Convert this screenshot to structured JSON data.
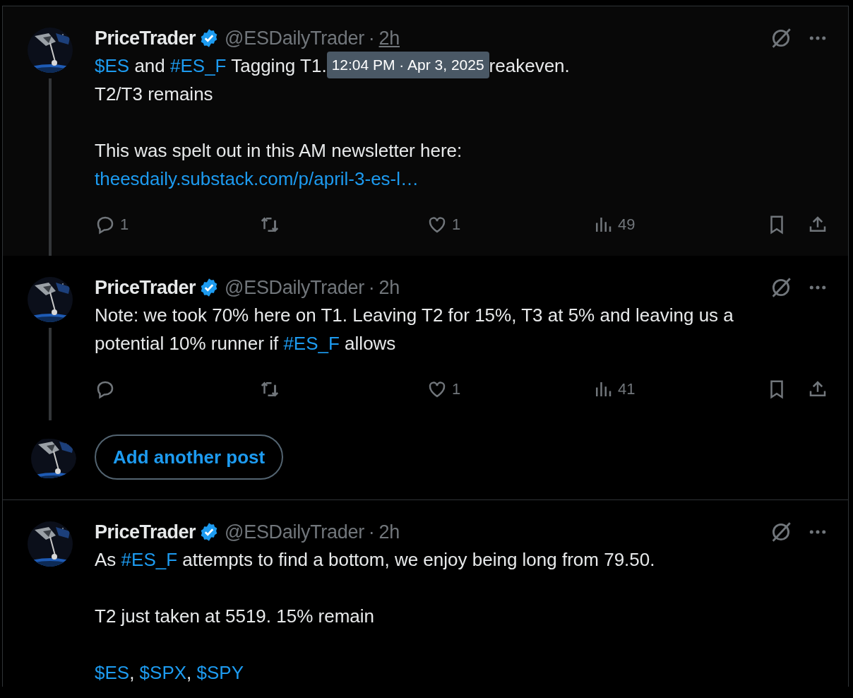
{
  "posts": [
    {
      "name": "PriceTrader",
      "verified": true,
      "handle": "@ESDailyTrader",
      "separator": "·",
      "time": "2h",
      "hovered": true,
      "thread_line": true,
      "paragraphs": [
        [
          [
            {
              "kind": "link",
              "text": "$ES"
            },
            {
              "kind": "text",
              "text": " and "
            },
            {
              "kind": "link",
              "text": "#ES_F"
            },
            {
              "kind": "text",
              "text": " Tagging T1."
            },
            {
              "kind": "tooltip",
              "text": "12:04 PM · Apr 3, 2025"
            },
            {
              "kind": "text",
              "text": "reakeven."
            }
          ],
          [
            {
              "kind": "text",
              "text": "T2/T3 remains"
            }
          ]
        ],
        [
          [
            {
              "kind": "text",
              "text": "This was spelt out in this AM newsletter here:"
            }
          ],
          [
            {
              "kind": "link",
              "text": "theesdaily.substack.com/p/april-3-es-l…"
            }
          ]
        ]
      ],
      "actions": {
        "replies": "1",
        "likes": "1",
        "views": "49"
      }
    },
    {
      "name": "PriceTrader",
      "verified": true,
      "handle": "@ESDailyTrader",
      "separator": "·",
      "time": "2h",
      "hovered": false,
      "thread_line": true,
      "paragraphs": [
        [
          [
            {
              "kind": "text",
              "text": "Note: we took 70% here on T1. Leaving T2 for 15%, T3 at 5% and leaving us a"
            }
          ],
          [
            {
              "kind": "text",
              "text": "potential 10% runner if "
            },
            {
              "kind": "link",
              "text": "#ES_F"
            },
            {
              "kind": "text",
              "text": " allows"
            }
          ]
        ]
      ],
      "actions": {
        "likes": "1",
        "views": "41"
      }
    },
    {
      "kind": "compose",
      "button": "Add another post"
    },
    {
      "name": "PriceTrader",
      "verified": true,
      "handle": "@ESDailyTrader",
      "separator": "·",
      "time": "2h",
      "hovered": false,
      "thread_line": false,
      "paragraphs": [
        [
          [
            {
              "kind": "text",
              "text": "As "
            },
            {
              "kind": "link",
              "text": "#ES_F"
            },
            {
              "kind": "text",
              "text": " attempts to find a bottom, we enjoy being long from 79.50."
            }
          ]
        ],
        [
          [
            {
              "kind": "text",
              "text": "T2 just taken at 5519. 15% remain"
            }
          ]
        ],
        [
          [
            {
              "kind": "link",
              "text": "$ES"
            },
            {
              "kind": "text",
              "text": ", "
            },
            {
              "kind": "link",
              "text": "$SPX"
            },
            {
              "kind": "text",
              "text": ", "
            },
            {
              "kind": "link",
              "text": "$SPY"
            }
          ]
        ]
      ]
    }
  ]
}
